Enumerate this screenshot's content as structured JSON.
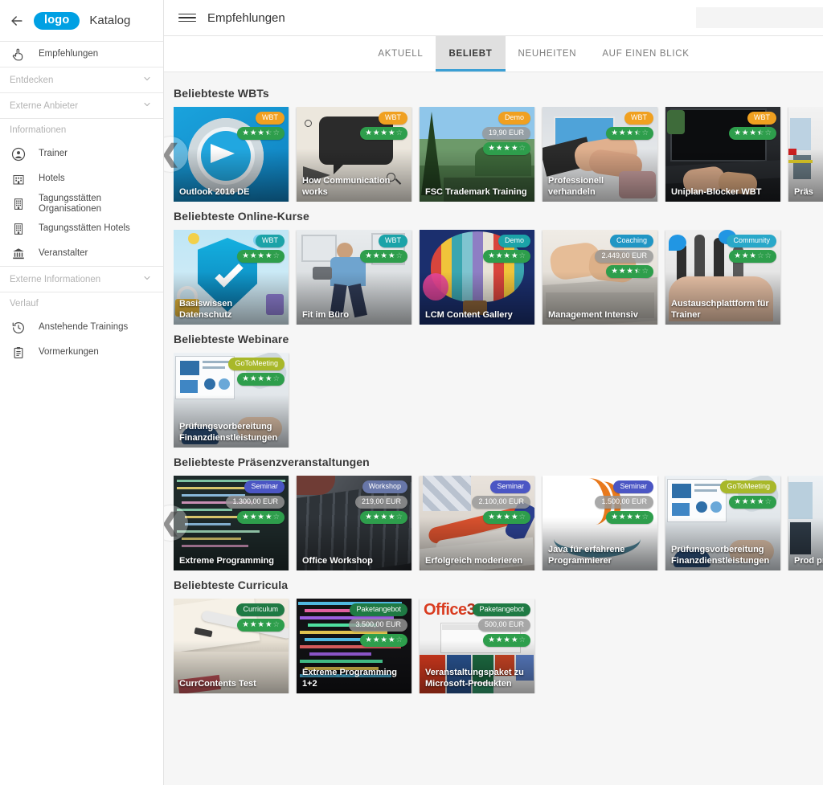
{
  "sidebar": {
    "back_icon": "back-arrow-icon",
    "logo_text": "logo",
    "app_title": "Katalog",
    "recommend": {
      "label": "Empfehlungen",
      "icon": "hand-pointer-icon"
    },
    "groups": [
      {
        "label": "Entdecken",
        "icon": "chevron-down-icon"
      },
      {
        "label": "Externe Anbieter",
        "icon": "chevron-down-icon"
      }
    ],
    "section_informationen": "Informationen",
    "info_items": [
      {
        "label": "Trainer",
        "icon": "user-circle-icon"
      },
      {
        "label": "Hotels",
        "icon": "hotel-icon"
      },
      {
        "label": "Tagungsstätten Organisationen",
        "icon": "building-icon"
      },
      {
        "label": "Tagungsstätten Hotels",
        "icon": "building-icon"
      },
      {
        "label": "Veranstalter",
        "icon": "bank-icon"
      }
    ],
    "group_externe_informationen": {
      "label": "Externe Informationen",
      "icon": "chevron-down-icon"
    },
    "section_verlauf": "Verlauf",
    "verlauf_items": [
      {
        "label": "Anstehende Trainings",
        "icon": "history-clock-icon"
      },
      {
        "label": "Vormerkungen",
        "icon": "clipboard-icon"
      }
    ]
  },
  "topbar": {
    "menu_icon": "hamburger-menu-icon",
    "title": "Empfehlungen",
    "search_placeholder": "",
    "search_value": "",
    "search_icon": "search-icon"
  },
  "tabs": [
    {
      "label": "AKTUELL",
      "active": false
    },
    {
      "label": "BELIEBT",
      "active": true
    },
    {
      "label": "NEUHEITEN",
      "active": false
    },
    {
      "label": "AUF EINEN BLICK",
      "active": false
    }
  ],
  "colors": {
    "accent": "#3b9fd4",
    "logo": "#00a0e3",
    "rating_green": "#2e9e4c",
    "badge_wbt_orange": "#f0a020",
    "badge_wbt_teal": "#1ba3a8",
    "badge_demo_orange": "#f0a020",
    "badge_demo_teal": "#1ba3a8",
    "badge_coaching": "#2196c4",
    "badge_community": "#29a8c9",
    "badge_gotomeeting": "#a8b82a",
    "badge_seminar": "#4b56c4",
    "badge_workshop": "#6877a8",
    "badge_curriculum": "#1f7a44",
    "badge_paket": "#1f7a44",
    "badge_price_gray": "#969696"
  },
  "sections": [
    {
      "title": "Beliebteste WBTs",
      "has_left_arrow": true,
      "has_right_arrow": true,
      "cards": [
        {
          "title": "Outlook 2016 DE",
          "badge": "WBT",
          "badge_color": "#f0a020",
          "price": null,
          "stars": 3.5,
          "art": "outlook"
        },
        {
          "title": "How Communication works",
          "badge": "WBT",
          "badge_color": "#f0a020",
          "price": null,
          "stars": 4,
          "art": "doodle"
        },
        {
          "title": "FSC Trademark Training",
          "badge": "Demo",
          "badge_color": "#f0a020",
          "price": "19,90 EUR",
          "stars": 4,
          "art": "forest"
        },
        {
          "title": "Professionell verhandeln",
          "badge": "WBT",
          "badge_color": "#f0a020",
          "price": null,
          "stars": 3.5,
          "art": "handshake"
        },
        {
          "title": "Uniplan-Blocker WBT",
          "badge": "WBT",
          "badge_color": "#f0a020",
          "price": null,
          "stars": 3.5,
          "art": "laptop"
        },
        {
          "title": "Präs",
          "badge": null,
          "badge_color": null,
          "price": null,
          "stars": null,
          "art": "partial"
        }
      ]
    },
    {
      "title": "Beliebteste Online-Kurse",
      "has_left_arrow": false,
      "has_right_arrow": false,
      "cards": [
        {
          "title": "Basiswissen Datenschutz",
          "badge": "WBT",
          "badge_color": "#1ba3a8",
          "price": null,
          "stars": 4,
          "art": "shield"
        },
        {
          "title": "Fit im Büro",
          "badge": "WBT",
          "badge_color": "#1ba3a8",
          "price": null,
          "stars": 4,
          "art": "office-fit"
        },
        {
          "title": "LCM Content Gallery",
          "badge": "Demo",
          "badge_color": "#1ba3a8",
          "price": null,
          "stars": 4,
          "art": "balloon"
        },
        {
          "title": "Management Intensiv",
          "badge": "Coaching",
          "badge_color": "#2196c4",
          "price": "2.449,00 EUR",
          "stars": 3.5,
          "art": "typing"
        },
        {
          "title": "Austauschplattform für Trainer",
          "badge": "Community",
          "badge_color": "#29a8c9",
          "price": null,
          "stars": 3,
          "art": "fingers"
        }
      ]
    },
    {
      "title": "Beliebteste Webinare",
      "has_left_arrow": false,
      "has_right_arrow": false,
      "cards": [
        {
          "title": "Prüfungsvorbereitung Finanzdienstleistungen",
          "badge": "GoToMeeting",
          "badge_color": "#a8b82a",
          "price": null,
          "stars": 4,
          "art": "desk-charts"
        }
      ]
    },
    {
      "title": "Beliebteste Präsenzveranstaltungen",
      "has_left_arrow": true,
      "has_right_arrow": true,
      "cards": [
        {
          "title": "Extreme Programming",
          "badge": "Seminar",
          "badge_color": "#4b56c4",
          "price": "1.300,00 EUR",
          "stars": 4,
          "art": "code-dark"
        },
        {
          "title": "Office Workshop",
          "badge": "Workshop",
          "badge_color": "#6877a8",
          "price": "219,00 EUR",
          "stars": 4,
          "art": "keyboard"
        },
        {
          "title": "Erfolgreich moderieren",
          "badge": "Seminar",
          "badge_color": "#4b56c4",
          "price": "2.100,00 EUR",
          "stars": 4,
          "art": "markers"
        },
        {
          "title": "Java für erfahrene Programmierer",
          "badge": "Seminar",
          "badge_color": "#4b56c4",
          "price": "1.500,00 EUR",
          "stars": 4,
          "art": "java"
        },
        {
          "title": "Prüfungsvorbereitung Finanzdienstleistungen",
          "badge": "GoToMeeting",
          "badge_color": "#a8b82a",
          "price": null,
          "stars": 4,
          "art": "desk-charts"
        },
        {
          "title": "Prod präs",
          "badge": null,
          "badge_color": null,
          "price": null,
          "stars": null,
          "art": "partial2"
        }
      ]
    },
    {
      "title": "Beliebteste Curricula",
      "has_left_arrow": false,
      "has_right_arrow": false,
      "cards": [
        {
          "title": "CurrContents Test",
          "badge": "Curriculum",
          "badge_color": "#1f7a44",
          "price": null,
          "stars": 4,
          "art": "notebook"
        },
        {
          "title": "Extreme Programming 1+2",
          "badge": "Paketangebot",
          "badge_color": "#1f7a44",
          "price": "3.500,00 EUR",
          "stars": 4,
          "art": "code-color"
        },
        {
          "title": "Veranstaltungspaket zu Microsoft-Produkten",
          "badge": "Paketangebot",
          "badge_color": "#1f7a44",
          "price": "500,00 EUR",
          "stars": 4,
          "art": "office365"
        }
      ]
    }
  ]
}
